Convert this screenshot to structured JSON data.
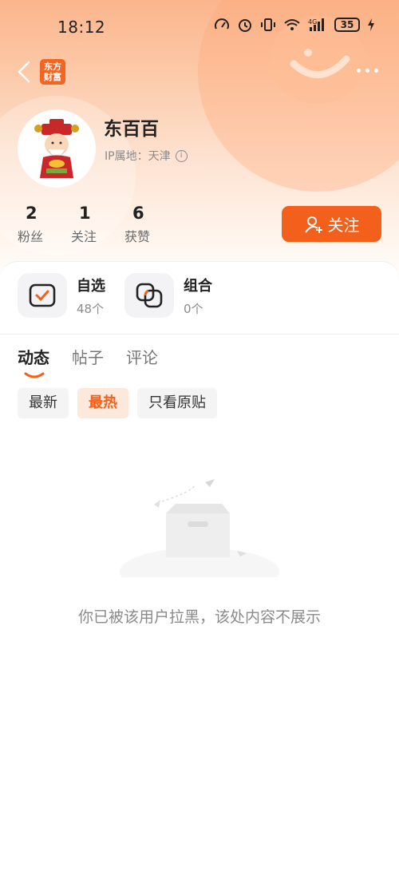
{
  "status_bar": {
    "time": "18:12",
    "battery": "35"
  },
  "nav": {
    "logo_text_line1": "东方",
    "logo_text_line2": "财富"
  },
  "profile": {
    "username": "东百百",
    "ip_label": "IP属地：天津"
  },
  "stats": [
    {
      "value": "2",
      "label": "粉丝"
    },
    {
      "value": "1",
      "label": "关注"
    },
    {
      "value": "6",
      "label": "获赞"
    }
  ],
  "follow_button": {
    "label": "关注"
  },
  "watchlist": [
    {
      "title": "自选",
      "count": "48个"
    },
    {
      "title": "组合",
      "count": "0个"
    }
  ],
  "tabs": [
    {
      "label": "动态",
      "active": true
    },
    {
      "label": "帖子",
      "active": false
    },
    {
      "label": "评论",
      "active": false
    }
  ],
  "filters": [
    {
      "label": "最新",
      "active": false
    },
    {
      "label": "最热",
      "active": true
    },
    {
      "label": "只看原贴",
      "active": false
    }
  ],
  "empty_state": {
    "message": "你已被该用户拉黑，该处内容不展示"
  },
  "colors": {
    "accent": "#f2601c",
    "header_top": "#fbb58c"
  }
}
